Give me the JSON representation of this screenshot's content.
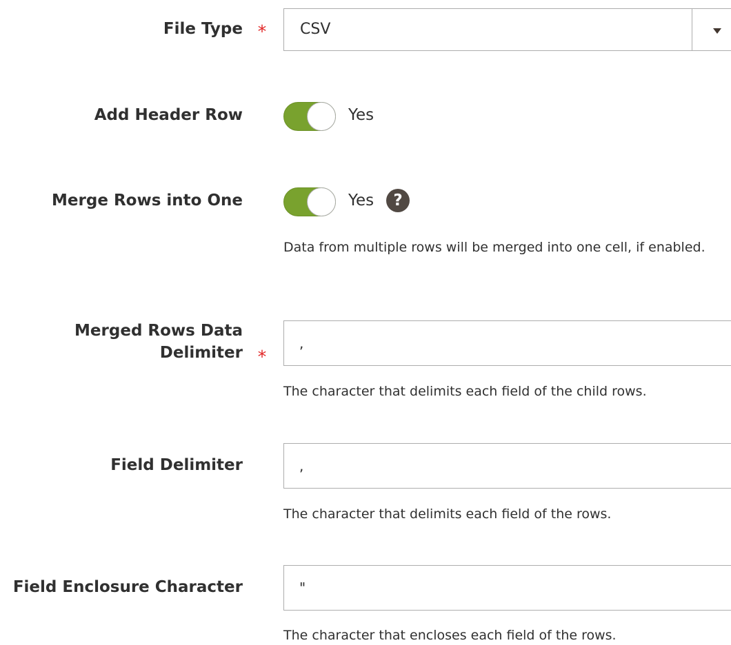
{
  "file_type": {
    "label": "File Type",
    "required_marker": "*",
    "selected_value": "CSV",
    "arrow_icon": "chevron-down-icon"
  },
  "add_header_row": {
    "label": "Add Header Row",
    "state": "on",
    "value_text": "Yes",
    "accent_color": "#79a22e"
  },
  "merge_rows": {
    "label": "Merge Rows into One",
    "state": "on",
    "value_text": "Yes",
    "help_icon": "question-mark-icon",
    "help_glyph": "?",
    "note": "Data from multiple rows will be merged into one cell, if enabled."
  },
  "merged_rows_delimiter": {
    "label_line1": "Merged Rows Data",
    "label_line2": "Delimiter",
    "required_marker": "*",
    "value": ",",
    "note": "The character that delimits each field of the child rows."
  },
  "field_delimiter": {
    "label": "Field Delimiter",
    "value": ",",
    "note": "The character that delimits each field of the rows."
  },
  "field_enclosure": {
    "label": "Field Enclosure Character",
    "value": "\"",
    "note": "The character that encloses each field of the rows."
  },
  "colors": {
    "required": "#e22626",
    "toggle_on": "#79a22e",
    "help_icon_bg": "#514943",
    "border": "#adadad",
    "text": "#303030"
  }
}
